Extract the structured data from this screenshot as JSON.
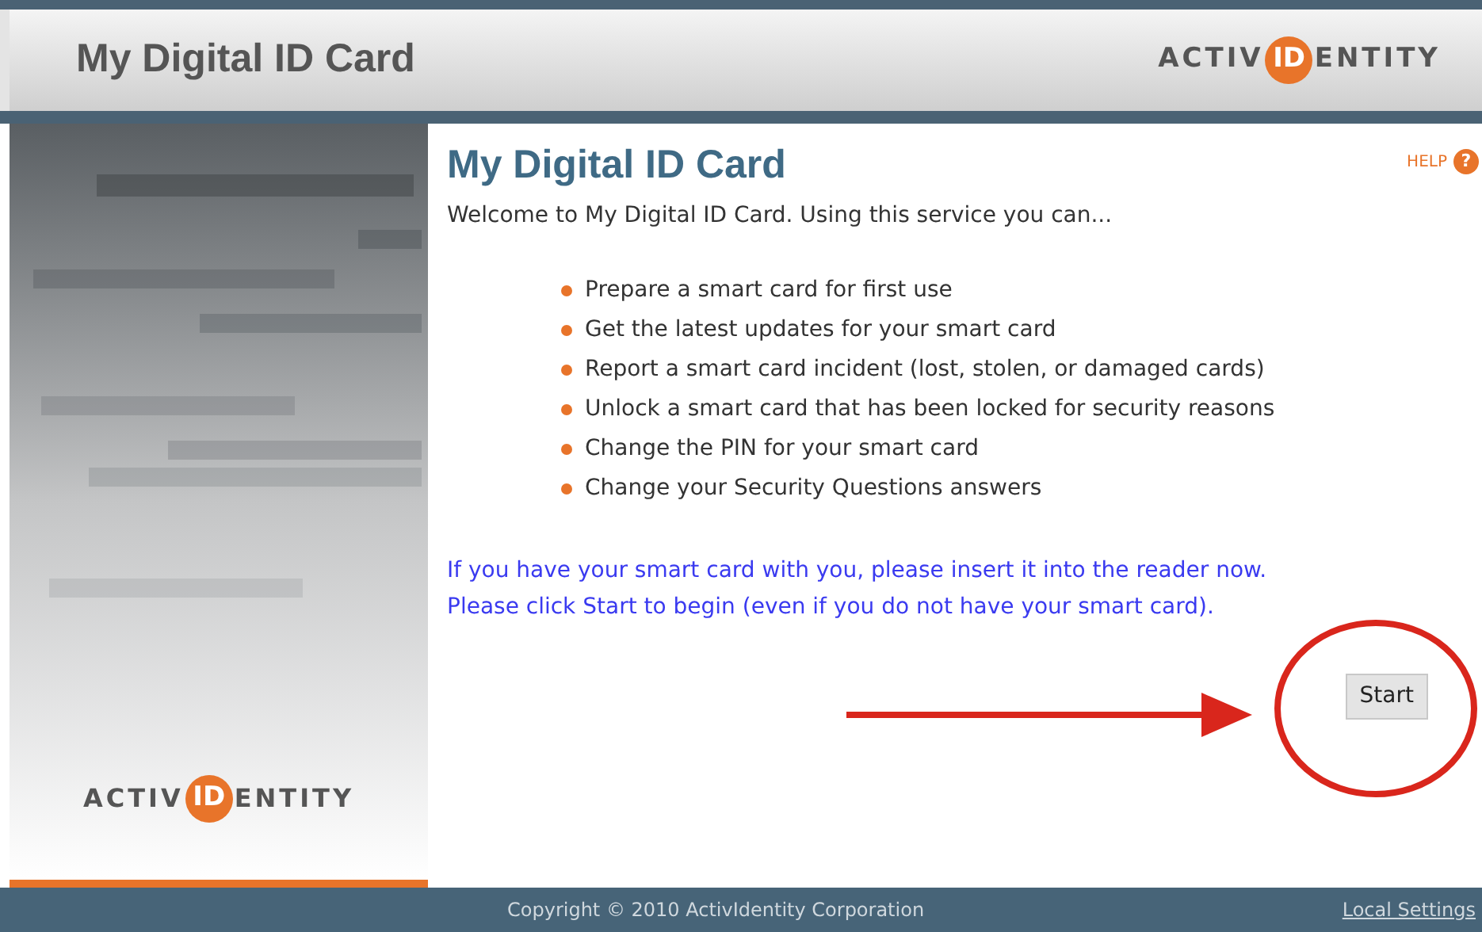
{
  "header": {
    "title": "My Digital ID Card",
    "logo": {
      "left": "ACTIV",
      "mark": "ID",
      "right": "ENTITY"
    }
  },
  "sidebar": {
    "logo": {
      "left": "ACTIV",
      "mark": "ID",
      "right": "ENTITY"
    }
  },
  "content": {
    "title": "My Digital ID Card",
    "help": "HELP",
    "help_icon": "?",
    "intro": "Welcome to My Digital ID Card. Using this service you can...",
    "features": [
      "Prepare a smart card for first use",
      "Get the latest updates for your smart card",
      "Report a smart card incident (lost, stolen, or damaged cards)",
      "Unlock a smart card that has been locked for security reasons",
      "Change the PIN for your smart card",
      "Change your Security Questions answers"
    ],
    "instructions": [
      "If you have your smart card with you, please insert it into the reader now.",
      "Please click Start to begin (even if you do not have your smart card)."
    ],
    "start_button": "Start"
  },
  "footer": {
    "copyright": "Copyright © 2010 ActivIdentity Corporation",
    "link": "Local Settings"
  }
}
